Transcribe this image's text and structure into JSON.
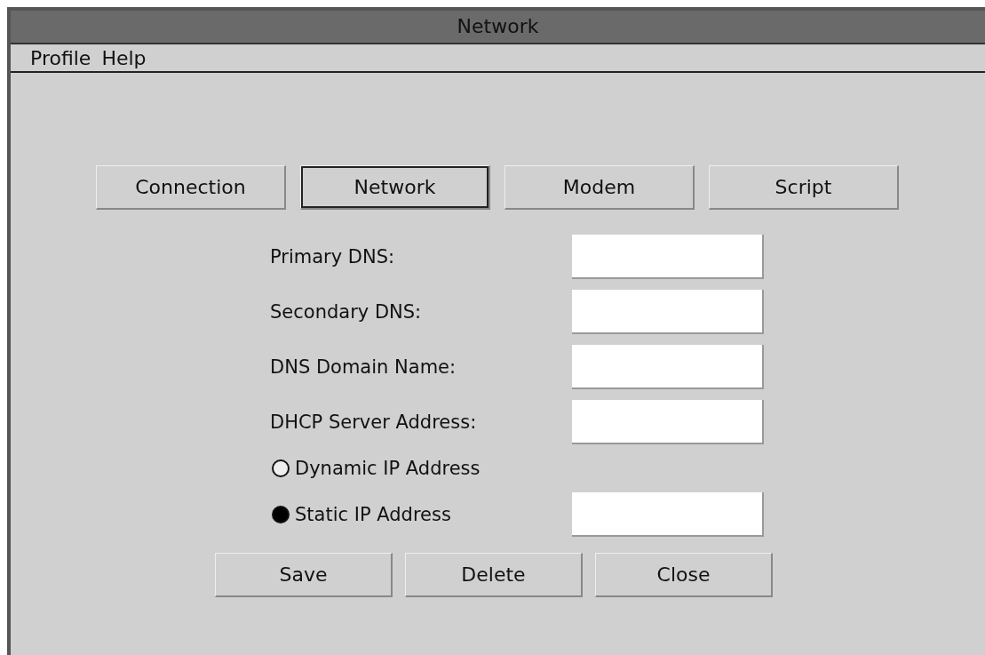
{
  "window": {
    "title": "Network"
  },
  "menu": [
    "Profile",
    "Help"
  ],
  "tabs": [
    {
      "label": "Connection",
      "selected": false
    },
    {
      "label": "Network",
      "selected": true
    },
    {
      "label": "Modem",
      "selected": false
    },
    {
      "label": "Script",
      "selected": false
    }
  ],
  "form": [
    {
      "kind": "field",
      "label": "Primary DNS:"
    },
    {
      "kind": "field",
      "label": "Secondary DNS:"
    },
    {
      "kind": "field",
      "label": "DNS Domain Name:"
    },
    {
      "kind": "field",
      "label": "DHCP Server Address:"
    },
    {
      "kind": "radio",
      "label": "Dynamic IP Address",
      "selected": false
    },
    {
      "kind": "radio_field",
      "label": "Static IP Address",
      "selected": true
    }
  ],
  "buttons": [
    "Save",
    "Delete",
    "Close"
  ]
}
